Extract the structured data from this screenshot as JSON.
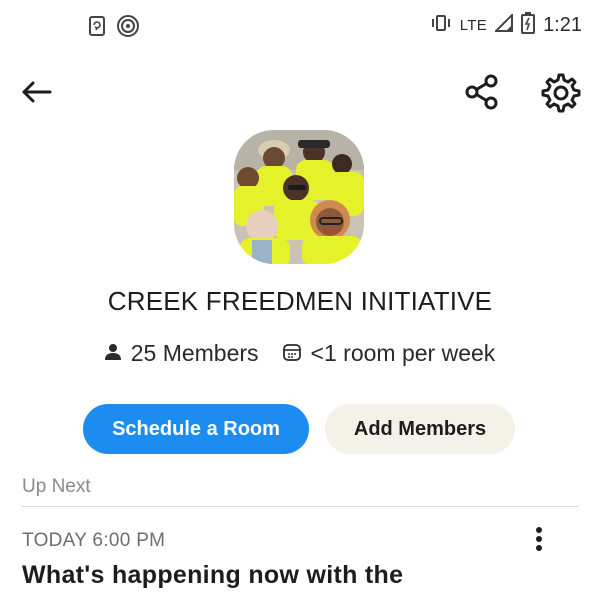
{
  "status_bar": {
    "network": "LTE",
    "time": "1:21"
  },
  "club": {
    "title": "CREEK FREEDMEN INITIATIVE",
    "members": "25 Members",
    "frequency": "<1 room per week"
  },
  "actions": {
    "schedule_label": "Schedule a Room",
    "add_members_label": "Add Members"
  },
  "up_next": {
    "label": "Up Next",
    "event_time": "TODAY 6:00 PM",
    "event_title": "What's happening now with the"
  },
  "colors": {
    "primary_button": "#1d8cf0",
    "secondary_button": "#f3f1e8",
    "shirt_yellow": "#e6f229"
  },
  "icons": [
    "phone-sync-icon",
    "nfc-icon",
    "vibrate-icon",
    "signal-icon",
    "battery-icon",
    "back-arrow-icon",
    "share-icon",
    "settings-icon",
    "person-icon",
    "calendar-icon",
    "more-vertical-icon"
  ]
}
